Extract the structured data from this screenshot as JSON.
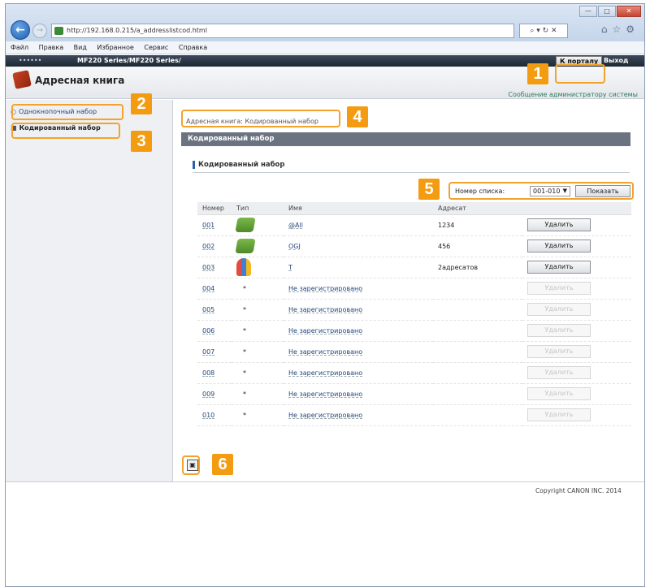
{
  "browser": {
    "url": "http://192.168.0.215/a_addresslistcod.html",
    "addr_tools": "⌕ ▾ ↻ ✕",
    "menu": [
      "Файл",
      "Правка",
      "Вид",
      "Избранное",
      "Сервис",
      "Справка"
    ]
  },
  "header": {
    "device": "••••••",
    "series": "MF220 Series/MF220 Series/",
    "portal_btn": "К порталу",
    "logout": "Выход",
    "page_title": "Адресная книга",
    "sys_message": "Сообщение администратору системы"
  },
  "sidebar": {
    "items": [
      {
        "label": "Однокнопочный набор"
      },
      {
        "label": "Кодированный набор"
      }
    ]
  },
  "main": {
    "breadcrumb": "Адресная книга: Кодированный набор",
    "section_title": "Кодированный набор",
    "subheading": "Кодированный набор",
    "list_label": "Номер списка:",
    "list_value": "001-010",
    "show_btn": "Показать",
    "columns": {
      "num": "Номер",
      "type": "Тип",
      "name": "Имя",
      "dest": "Адресат"
    },
    "rows": [
      {
        "num": "001",
        "type": "fax-icon",
        "name": "@All",
        "dest": "1234",
        "btn": "Удалить",
        "enabled": true
      },
      {
        "num": "002",
        "type": "fax-icon",
        "name": "OGJ",
        "dest": "456",
        "btn": "Удалить",
        "enabled": true
      },
      {
        "num": "003",
        "type": "group-icon",
        "name": "T",
        "dest": "2адресатов",
        "btn": "Удалить",
        "enabled": true
      },
      {
        "num": "004",
        "type": "*",
        "name": "Не зарегистрировано",
        "dest": "",
        "btn": "Удалить",
        "enabled": false
      },
      {
        "num": "005",
        "type": "*",
        "name": "Не зарегистрировано",
        "dest": "",
        "btn": "Удалить",
        "enabled": false
      },
      {
        "num": "006",
        "type": "*",
        "name": "Не зарегистрировано",
        "dest": "",
        "btn": "Удалить",
        "enabled": false
      },
      {
        "num": "007",
        "type": "*",
        "name": "Не зарегистрировано",
        "dest": "",
        "btn": "Удалить",
        "enabled": false
      },
      {
        "num": "008",
        "type": "*",
        "name": "Не зарегистрировано",
        "dest": "",
        "btn": "Удалить",
        "enabled": false
      },
      {
        "num": "009",
        "type": "*",
        "name": "Не зарегистрировано",
        "dest": "",
        "btn": "Удалить",
        "enabled": false
      },
      {
        "num": "010",
        "type": "*",
        "name": "Не зарегистрировано",
        "dest": "",
        "btn": "Удалить",
        "enabled": false
      }
    ]
  },
  "footer": {
    "copyright": "Copyright CANON INC. 2014"
  },
  "callouts": [
    "1",
    "2",
    "3",
    "4",
    "5",
    "6"
  ],
  "colors": {
    "callout": "#f39c12",
    "header_dark": "#1e2733",
    "section_bar": "#6b7280"
  }
}
